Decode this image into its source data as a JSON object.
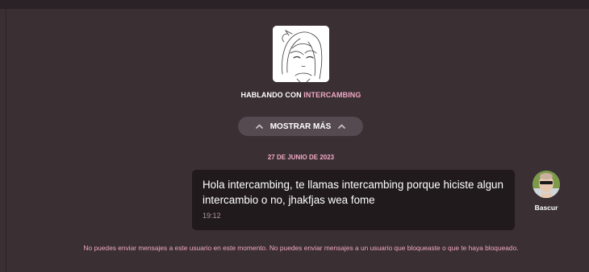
{
  "header": {
    "talking_prefix": "HABLANDO CON",
    "contact_name": "INTERCAMBING",
    "avatar_icon": "anime-girl-sketch-avatar"
  },
  "history": {
    "show_more_label": "MOSTRAR MÁS",
    "chevron_icon": "chevron-up-icon"
  },
  "date_separator": "27 DE JUNIO DE 2023",
  "messages": [
    {
      "text": "Hola intercambing, te llamas intercambing porque hiciste algun intercambio o no, jhakfjas wea fome",
      "time": "19:12",
      "sender": "Bascur",
      "avatar_icon": "user-photo-avatar"
    }
  ],
  "footer": {
    "blocked_notice": "No puedes enviar mensajes a este usuario en este momento. No puedes enviar mensajes a un usuario que bloqueaste o que te haya bloqueado."
  },
  "colors": {
    "background": "#3a2f33",
    "accent_pink": "#f0a9c4",
    "bubble": "#211a1d",
    "button": "#544a4f"
  }
}
